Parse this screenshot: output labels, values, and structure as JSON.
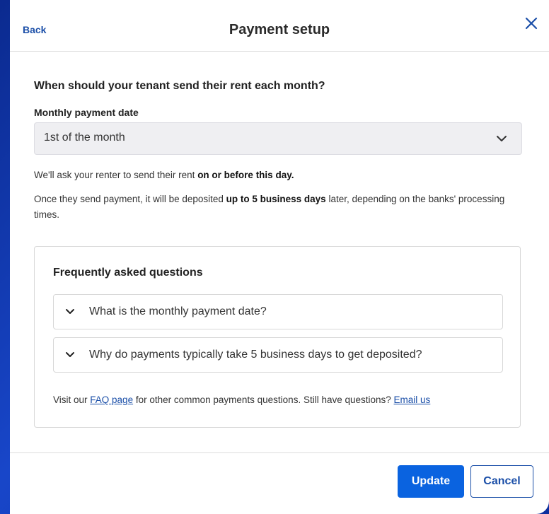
{
  "header": {
    "back_label": "Back",
    "title": "Payment setup",
    "close_icon": "close-icon"
  },
  "form": {
    "question": "When should your tenant send their rent each month?",
    "field_label": "Monthly payment date",
    "selected_value": "1st of the month",
    "dropdown_icon": "chevron-down-icon"
  },
  "info": {
    "line1_before": "We'll ask your renter to send their rent ",
    "line1_bold": "on or before this day.",
    "line2_before": "Once they send payment, it will be deposited ",
    "line2_bold": "up to 5 business days",
    "line2_after": " later, depending on the banks' processing times."
  },
  "faq": {
    "title": "Frequently asked questions",
    "items": [
      {
        "label": "What is the monthly payment date?"
      },
      {
        "label": "Why do payments typically take 5 business days to get deposited?"
      }
    ],
    "footer_before": "Visit our ",
    "faq_link": "FAQ page",
    "footer_middle": " for other common payments questions. Still have questions? ",
    "email_link": "Email us"
  },
  "buttons": {
    "update_label": "Update",
    "cancel_label": "Cancel"
  },
  "colors": {
    "accent": "#0a63e0",
    "link": "#1b4fa8",
    "background": "#1846c9"
  }
}
